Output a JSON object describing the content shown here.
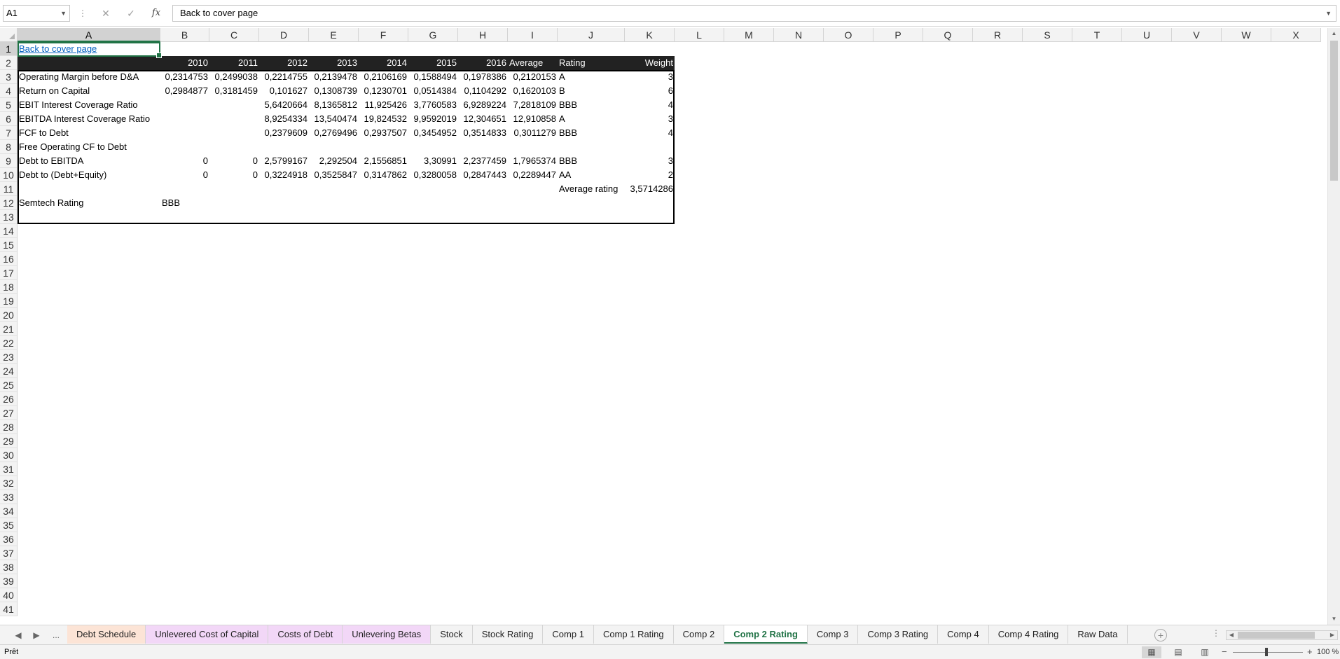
{
  "formula_bar": {
    "name_box": "A1",
    "formula": "Back to cover page",
    "cancel_icon": "close-icon",
    "confirm_icon": "check-icon",
    "fx_label": "fx"
  },
  "columns": [
    "A",
    "B",
    "C",
    "D",
    "E",
    "F",
    "G",
    "H",
    "I",
    "J",
    "K",
    "L",
    "M",
    "N",
    "O",
    "P",
    "Q",
    "R",
    "S",
    "T",
    "U",
    "V",
    "W",
    "X"
  ],
  "row_numbers": [
    "1",
    "2",
    "3",
    "4",
    "5",
    "6",
    "7",
    "8",
    "9",
    "10",
    "11",
    "12",
    "13",
    "14",
    "15",
    "16",
    "17",
    "18",
    "19",
    "20",
    "21",
    "22",
    "23",
    "24",
    "25",
    "26",
    "27",
    "28",
    "29",
    "30",
    "31",
    "32",
    "33",
    "34",
    "35",
    "36",
    "37",
    "38",
    "39",
    "40",
    "41"
  ],
  "sheet": {
    "link": "Back to cover page",
    "header_row": [
      "",
      "2010",
      "2011",
      "2012",
      "2013",
      "2014",
      "2015",
      "2016",
      "Average",
      "Rating",
      "Weight"
    ],
    "rows": [
      [
        "Operating Margin before D&A",
        "0,2314753",
        "0,2499038",
        "0,2214755",
        "0,2139478",
        "0,2106169",
        "0,1588494",
        "0,1978386",
        "0,2120153",
        "A",
        "3"
      ],
      [
        "Return on Capital",
        "0,2984877",
        "0,3181459",
        "0,101627",
        "0,1308739",
        "0,1230701",
        "0,0514384",
        "0,1104292",
        "0,1620103",
        "B",
        "6"
      ],
      [
        "EBIT Interest Coverage Ratio",
        "",
        "",
        "5,6420664",
        "8,1365812",
        "11,925426",
        "3,7760583",
        "6,9289224",
        "7,2818109",
        "BBB",
        "4"
      ],
      [
        "EBITDA Interest Coverage Ratio",
        "",
        "",
        "8,9254334",
        "13,540474",
        "19,824532",
        "9,9592019",
        "12,304651",
        "12,910858",
        "A",
        "3"
      ],
      [
        "FCF to Debt",
        "",
        "",
        "0,2379609",
        "0,2769496",
        "0,2937507",
        "0,3454952",
        "0,3514833",
        "0,3011279",
        "BBB",
        "4"
      ],
      [
        "Free Operating CF to Debt",
        "",
        "",
        "",
        "",
        "",
        "",
        "",
        "",
        "",
        ""
      ],
      [
        "Debt to EBITDA",
        "0",
        "0",
        "2,5799167",
        "2,292504",
        "2,1556851",
        "3,30991",
        "2,2377459",
        "1,7965374",
        "BBB",
        "3"
      ],
      [
        "Debt to (Debt+Equity)",
        "0",
        "0",
        "0,3224918",
        "0,3525847",
        "0,3147862",
        "0,3280058",
        "0,2847443",
        "0,2289447",
        "AA",
        "2"
      ]
    ],
    "average_rating_label": "Average rating",
    "average_rating_value": "3,5714286",
    "company_rating_label": "Semtech Rating",
    "company_rating_value": "BBB"
  },
  "tabs": {
    "more": "...",
    "items": [
      {
        "label": "Debt Schedule",
        "color": "#fce4d6"
      },
      {
        "label": "Unlevered Cost of Capital",
        "color": "#f2d7f7"
      },
      {
        "label": "Costs of Debt",
        "color": "#f2d7f7"
      },
      {
        "label": "Unlevering Betas",
        "color": "#f2d7f7"
      },
      {
        "label": "Stock",
        "color": ""
      },
      {
        "label": "Stock Rating",
        "color": ""
      },
      {
        "label": "Comp 1",
        "color": ""
      },
      {
        "label": "Comp 1 Rating",
        "color": ""
      },
      {
        "label": "Comp 2",
        "color": ""
      },
      {
        "label": "Comp 2 Rating",
        "color": "",
        "active": true
      },
      {
        "label": "Comp 3",
        "color": ""
      },
      {
        "label": "Comp 3 Rating",
        "color": ""
      },
      {
        "label": "Comp 4",
        "color": ""
      },
      {
        "label": "Comp 4 Rating",
        "color": ""
      },
      {
        "label": "Raw Data",
        "color": ""
      }
    ]
  },
  "status": {
    "ready": "Prêt",
    "zoom": "100 %"
  },
  "colors": {
    "accent": "#217346",
    "header_dark": "#222222",
    "link": "#0563c1"
  }
}
